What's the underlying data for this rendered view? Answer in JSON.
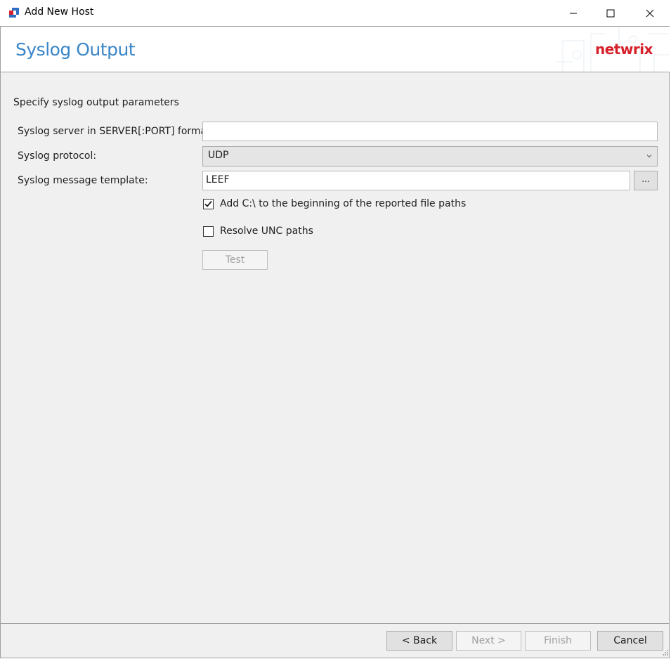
{
  "window": {
    "title": "Add New Host",
    "controls": {
      "minimize": "minimize-icon",
      "maximize": "maximize-icon",
      "close": "close-icon"
    }
  },
  "header": {
    "title": "Syslog Output",
    "logo": "netwrix",
    "title_color": "#3a86c8",
    "logo_color": "#d6202a"
  },
  "form": {
    "instructions": "Specify syslog output parameters",
    "server_label": "Syslog server in SERVER[:PORT] format:",
    "server_value": "",
    "protocol_label": "Syslog protocol:",
    "protocol_value": "UDP",
    "template_label": "Syslog message template:",
    "template_value": "LEEF",
    "browse_label": "...",
    "add_c_label": "Add C:\\ to the beginning of the reported file paths",
    "add_c_checked": true,
    "resolve_unc_label": "Resolve UNC paths",
    "resolve_unc_checked": false,
    "test_label": "Test"
  },
  "footer": {
    "back_label": "< Back",
    "next_label": "Next >",
    "finish_label": "Finish",
    "cancel_label": "Cancel"
  }
}
